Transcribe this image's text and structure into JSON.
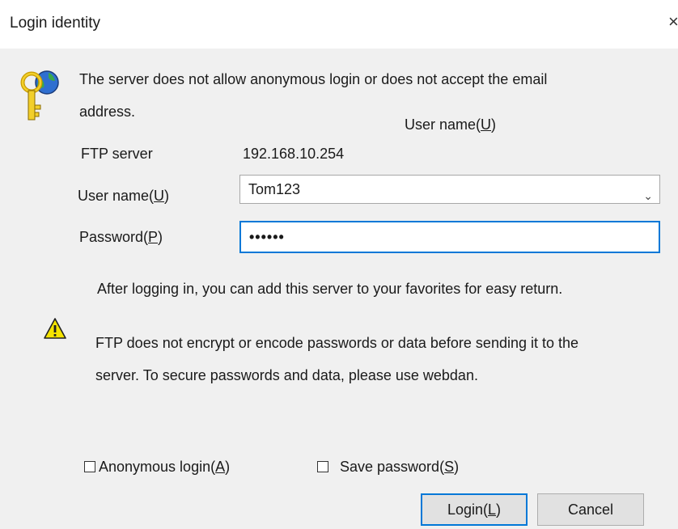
{
  "window": {
    "title": "Login identity",
    "close_glyph": "×"
  },
  "message": {
    "line1": "The server does not allow anonymous login or does not accept the email",
    "line2": "address."
  },
  "floating_label": {
    "text": "User name(",
    "key": "U",
    "suffix": ")"
  },
  "ftp_server": {
    "label": "FTP server",
    "value": "192.168.10.254"
  },
  "username": {
    "label": "User name(",
    "key": "U",
    "suffix": ")",
    "value": "Tom123"
  },
  "password": {
    "label": "Password(",
    "key": "P",
    "suffix": ")",
    "value": "••••••"
  },
  "info_text": "After logging in, you can add this server to your favorites for easy return.",
  "warning": {
    "line1": "FTP does not encrypt or encode passwords or data before sending it to the",
    "line2": "server. To secure passwords and data, please use webdan."
  },
  "checkboxes": {
    "anonymous": {
      "label": "Anonymous login(",
      "key": "A",
      "suffix": ")",
      "checked": false
    },
    "save_password": {
      "label": "Save password(",
      "key": "S",
      "suffix": ")",
      "checked": false
    }
  },
  "buttons": {
    "login": {
      "label": "Login(",
      "key": "L",
      "suffix": ")"
    },
    "cancel": {
      "label": "Cancel"
    }
  },
  "icons": {
    "login": "key-globe-icon",
    "warning": "warning-icon",
    "dropdown": "chevron-down-icon"
  },
  "colors": {
    "focus_border": "#0078d7",
    "dialog_bg": "#f0f0f0",
    "warning_yellow": "#f5e400"
  }
}
